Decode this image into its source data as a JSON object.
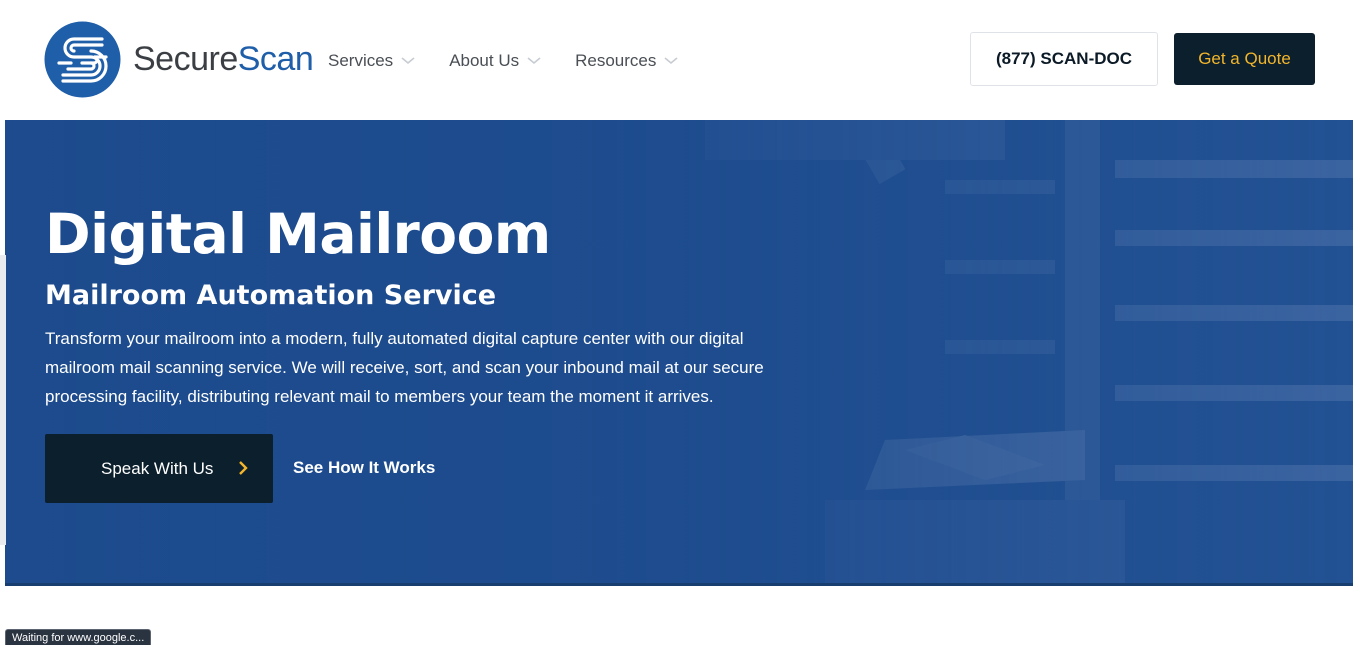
{
  "brand": {
    "name_part1": "Secure",
    "name_part2": "Scan",
    "primary_color": "#1f5ea8",
    "logo_icon": "securescan-s-logo-icon"
  },
  "nav": {
    "items": [
      {
        "label": "Services",
        "icon": "chevron-down-icon"
      },
      {
        "label": "About Us",
        "icon": "chevron-down-icon"
      },
      {
        "label": "Resources",
        "icon": "chevron-down-icon"
      }
    ]
  },
  "header_actions": {
    "phone_label": "(877) SCAN-DOC",
    "quote_label": "Get a Quote",
    "quote_text_color": "#f2b52b",
    "quote_bg_color": "#0c1f2d"
  },
  "hero": {
    "title": "Digital Mailroom",
    "subtitle": "Mailroom Automation Service",
    "description": "Transform your mailroom into a modern, fully automated digital capture center with our digital mailroom mail scanning service. We will receive, sort, and scan your inbound mail at our secure processing facility, distributing relevant mail to members your team the moment it arrives.",
    "primary_cta": "Speak With Us",
    "primary_cta_icon": "chevron-right-icon",
    "secondary_cta": "See How It Works",
    "overlay_color": "#1d4b8d"
  },
  "status_bar": {
    "text": "Waiting for www.google.c..."
  }
}
